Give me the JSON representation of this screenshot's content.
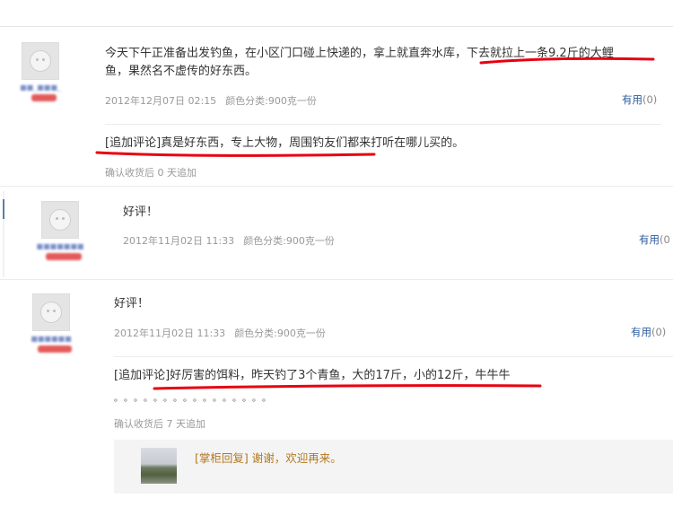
{
  "reviews": [
    {
      "text_part1": "今天下午正准备出发钓鱼，在小区门口碰上快递的，拿上就直奔水库，",
      "text_highlight": "下去就拉上一条9.2斤的大鲤",
      "text_line2": "鱼，果然名不虚传的好东西。",
      "date": "2012年12月07日 02:15",
      "variant": "颜色分类:900克一份",
      "useful_label": "有用",
      "useful_count": "(0)",
      "followup_text": "[追加评论]真是好东西，专上大物，周围钓友们都来打听在哪儿买的。",
      "followup_note": "确认收货后 0 天追加"
    },
    {
      "text": "好评！",
      "date": "2012年11月02日 11:33",
      "variant": "颜色分类:900克一份",
      "useful_label": "有用",
      "useful_count": "(0"
    },
    {
      "text": "好评！",
      "date": "2012年11月02日 11:33",
      "variant": "颜色分类:900克一份",
      "useful_label": "有用",
      "useful_count": "(0)",
      "followup_text": "[追加评论]好厉害的饵料，昨天钓了3个青鱼，大的17斤，小的12斤，牛牛牛",
      "followup_dots": "。。。。。。。。。。。。。。。。",
      "followup_note": "确认收货后 7 天追加",
      "reply_text": "[掌柜回复] 谢谢，欢迎再来。"
    }
  ],
  "colors": {
    "accent_link": "#2d5c9b",
    "reply_text": "#b3781f",
    "meta_text": "#999999",
    "annotation_red": "#e8000f"
  },
  "icons": [
    "avatar-placeholder-icon",
    "shop-reply-thumbnail"
  ]
}
